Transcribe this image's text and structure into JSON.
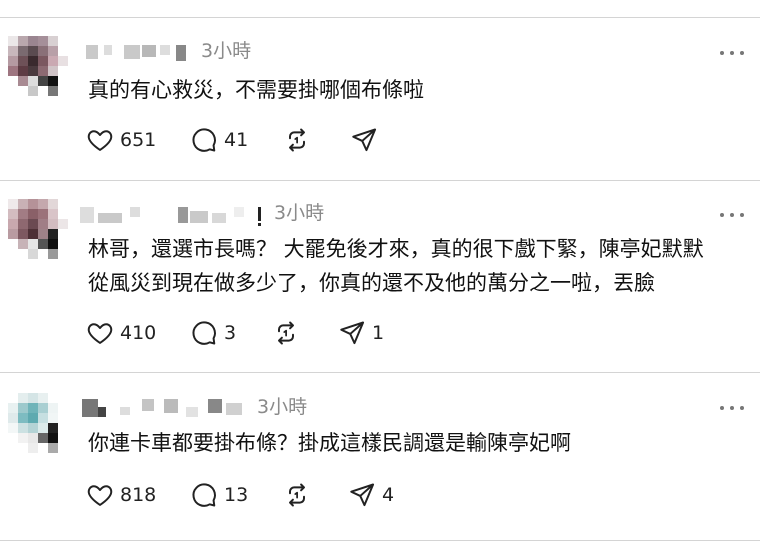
{
  "colors": {
    "divider": "#d4d4d4",
    "text": "#111111",
    "muted": "#8a8a8a",
    "icon_stroke": "#222222"
  },
  "posts": [
    {
      "time": "3小時",
      "lines": [
        "真的有心救災，不需要掛哪個布條啦"
      ],
      "likes": "651",
      "comments": "41",
      "reposts": "",
      "shares": ""
    },
    {
      "time": "3小時",
      "lines": [
        "林哥，還選市長嗎？ 大罷免後才來，真的很下戲下緊，陳亭妃默默",
        "從風災到現在做多少了，你真的還不及他的萬分之一啦，丟臉"
      ],
      "likes": "410",
      "comments": "3",
      "reposts": "",
      "shares": "1"
    },
    {
      "time": "3小時",
      "lines": [
        "你連卡車都要掛布條？掛成這樣民調還是輸陳亭妃啊"
      ],
      "likes": "818",
      "comments": "13",
      "reposts": "",
      "shares": "4"
    }
  ],
  "icons": {
    "like": "heart-icon",
    "comment": "speech-bubble-icon",
    "repost": "repost-arrows-icon",
    "share": "send-paper-plane-icon",
    "more": "more-dots-icon"
  }
}
